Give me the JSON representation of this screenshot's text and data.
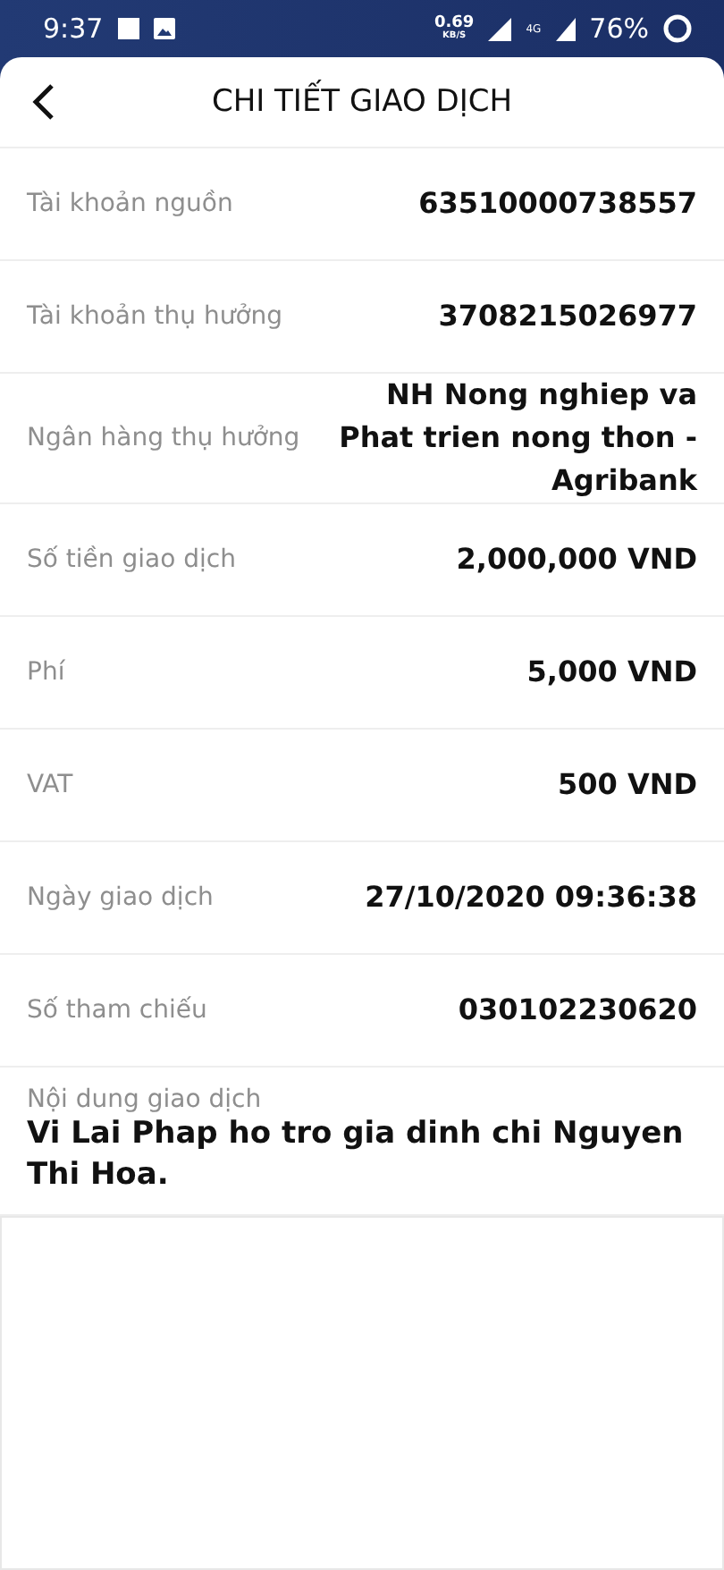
{
  "status_bar": {
    "time": "9:37",
    "speed": "0.69",
    "speed_unit": "KB/S",
    "network": "4G",
    "battery": "76%"
  },
  "header": {
    "title": "CHI TIẾT GIAO DỊCH"
  },
  "rows": [
    {
      "label": "Tài khoản nguồn",
      "value": "63510000738557"
    },
    {
      "label": "Tài khoản thụ hưởng",
      "value": "3708215026977"
    },
    {
      "label": "Ngân hàng thụ hưởng",
      "value": "NH Nong nghiep va Phat trien nong thon - Agribank"
    },
    {
      "label": "Số tiền giao dịch",
      "value": "2,000,000 VND"
    },
    {
      "label": "Phí",
      "value": "5,000 VND"
    },
    {
      "label": "VAT",
      "value": "500 VND"
    },
    {
      "label": "Ngày giao dịch",
      "value": "27/10/2020 09:36:38"
    },
    {
      "label": "Số tham chiếu",
      "value": "030102230620"
    }
  ],
  "content": {
    "label": "Nội dung giao dịch",
    "value": "Vi Lai Phap ho tro gia dinh chi Nguyen Thi Hoa."
  }
}
